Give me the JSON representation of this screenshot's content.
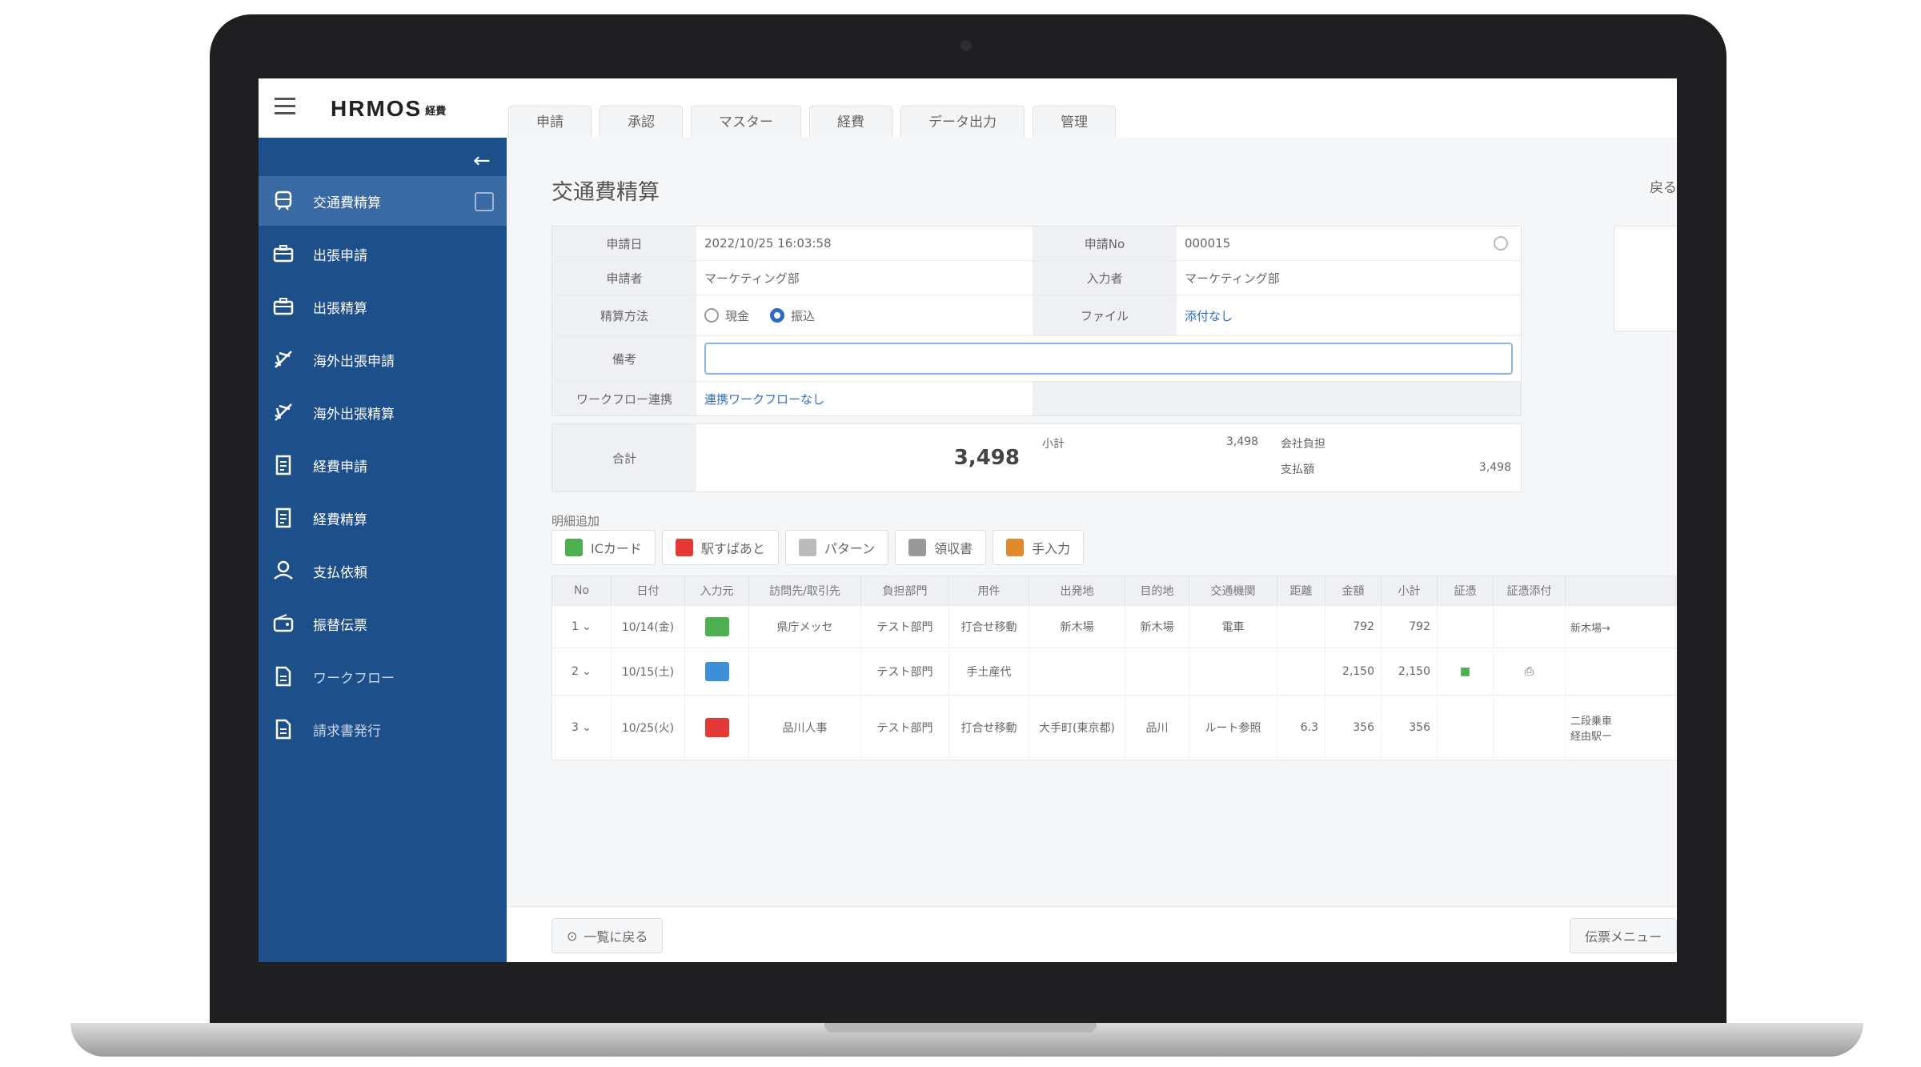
{
  "app": {
    "logo": "HRMOS",
    "logo_sub": "経費"
  },
  "tabs": [
    "申請",
    "承認",
    "マスター",
    "経費",
    "データ出力",
    "管理"
  ],
  "sidebar": {
    "items": [
      {
        "label": "交通費精算",
        "icon": "train-icon"
      },
      {
        "label": "出張申請",
        "icon": "briefcase-icon"
      },
      {
        "label": "出張精算",
        "icon": "briefcase-icon"
      },
      {
        "label": "海外出張申請",
        "icon": "airplane-icon"
      },
      {
        "label": "海外出張精算",
        "icon": "airplane-icon"
      },
      {
        "label": "経費申請",
        "icon": "receipt-icon"
      },
      {
        "label": "経費精算",
        "icon": "receipt-icon"
      },
      {
        "label": "支払依頼",
        "icon": "money-icon"
      },
      {
        "label": "振替伝票",
        "icon": "wallet-icon"
      },
      {
        "label": "ワークフロー",
        "icon": "document-icon"
      },
      {
        "label": "請求書発行",
        "icon": "document-icon"
      }
    ]
  },
  "page": {
    "title": "交通費精算",
    "top_right": "戻る"
  },
  "form": {
    "apply_date_label": "申請日",
    "apply_date": "2022/10/25 16:03:58",
    "number_label": "申請No",
    "number": "000015",
    "applicant_label": "申請者",
    "applicant": "マーケティング部",
    "input_label": "入力者",
    "input_by": "マーケティング部",
    "payment_label": "精算方法",
    "pay_opt1": "現金",
    "pay_opt2": "振込",
    "file_label": "ファイル",
    "file_link": "添付なし",
    "note_label": "備考",
    "workflow_label": "ワークフロー連携",
    "workflow_link": "連携ワークフローなし"
  },
  "total": {
    "label": "合計",
    "amount": "3,498",
    "sub_label": "小計",
    "sub_value": "3,498",
    "company_label": "会社負担",
    "pay_label": "支払額",
    "pay_value": "3,498"
  },
  "details_label": "明細追加",
  "toolbar": [
    {
      "label": "ICカード",
      "color": "#4caf50"
    },
    {
      "label": "駅すぱあと",
      "color": "#e53935"
    },
    {
      "label": "パターン",
      "color": "#bbbbbb"
    },
    {
      "label": "領収書",
      "color": "#999999"
    },
    {
      "label": "手入力",
      "color": "#e08a2c"
    }
  ],
  "table": {
    "headers": [
      "No",
      "日付",
      "入力元",
      "訪問先/取引先",
      "負担部門",
      "用件",
      "出発地",
      "目的地",
      "交通機関",
      "距離",
      "金額",
      "小計",
      "証憑",
      "証憑添付",
      ""
    ],
    "rows": [
      {
        "no": "1",
        "date": "10/14(金)",
        "src_color": "#4caf50",
        "visit": "県庁メッセ",
        "dept": "テスト部門",
        "purpose": "打合せ移動",
        "from": "新木場",
        "to": "新木場",
        "transit": "電車",
        "dist": "",
        "amount": "792",
        "subtotal": "792",
        "proof": "",
        "attach": "",
        "extra": "新木場→"
      },
      {
        "no": "2",
        "date": "10/15(土)",
        "src_color": "#3d8fd9",
        "visit": "",
        "dept": "テスト部門",
        "purpose": "手土産代",
        "from": "",
        "to": "",
        "transit": "",
        "dist": "",
        "amount": "2,150",
        "subtotal": "2,150",
        "proof": "■",
        "attach": "⎙",
        "extra": ""
      },
      {
        "no": "3",
        "date": "10/25(火)",
        "src_color": "#e53935",
        "visit": "品川人事",
        "dept": "テスト部門",
        "purpose": "打合せ移動",
        "from": "大手町(東京都)",
        "to": "品川",
        "transit": "ルート参照",
        "dist": "6.3",
        "amount": "356",
        "subtotal": "356",
        "proof": "",
        "attach": "",
        "extra": "二段乗車\n経由駅ー"
      }
    ]
  },
  "footer": {
    "back": "一覧に戻る",
    "menu": "伝票メニュー"
  }
}
